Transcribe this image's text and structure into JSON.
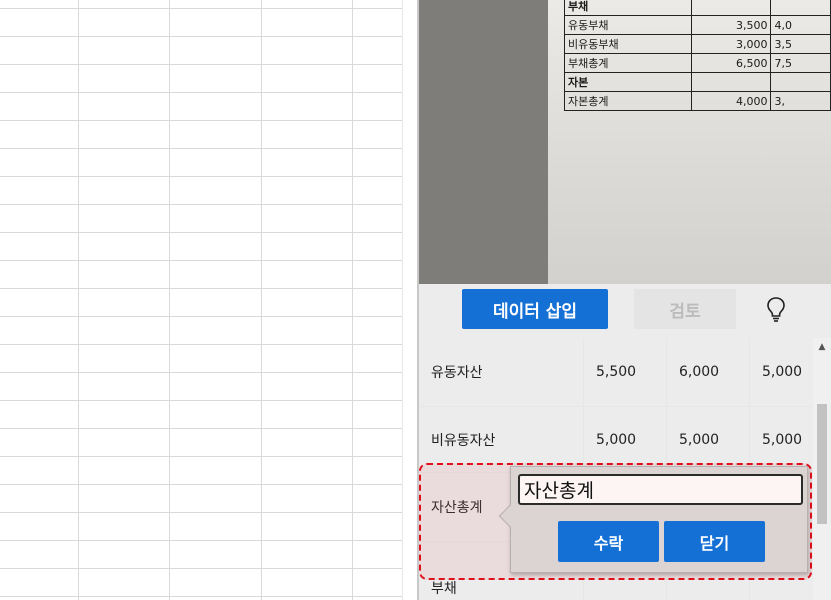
{
  "scan_preview": {
    "rows": [
      {
        "label": "부채",
        "bold": true,
        "v1": "",
        "v2": ""
      },
      {
        "label": "유동부채",
        "bold": false,
        "v1": "3,500",
        "v2": "4,0"
      },
      {
        "label": "비유동부채",
        "bold": false,
        "v1": "3,000",
        "v2": "3,5"
      },
      {
        "label": "부채총계",
        "bold": false,
        "v1": "6,500",
        "v2": "7,5"
      },
      {
        "label": "자본",
        "bold": true,
        "v1": "",
        "v2": ""
      },
      {
        "label": "자본총계",
        "bold": false,
        "v1": "4,000",
        "v2": "3,"
      }
    ]
  },
  "toolbar": {
    "insert_label": "데이터 삽입",
    "review_label": "검토",
    "tip_icon": "lightbulb-icon"
  },
  "table": {
    "rows": [
      {
        "label": "유동자산",
        "values": [
          "5,500",
          "6,000",
          "5,000"
        ]
      },
      {
        "label": "비유동자산",
        "values": [
          "5,000",
          "5,000",
          "5,000"
        ]
      },
      {
        "label": "자산총계",
        "values": [
          "",
          "",
          ""
        ]
      },
      {
        "label": "부채",
        "values": [
          "",
          "",
          ""
        ]
      }
    ]
  },
  "popup": {
    "field_value": "자산총계",
    "accept_label": "수락",
    "close_label": "닫기"
  },
  "colors": {
    "accent": "#1570d6",
    "highlight": "#e0101a"
  }
}
